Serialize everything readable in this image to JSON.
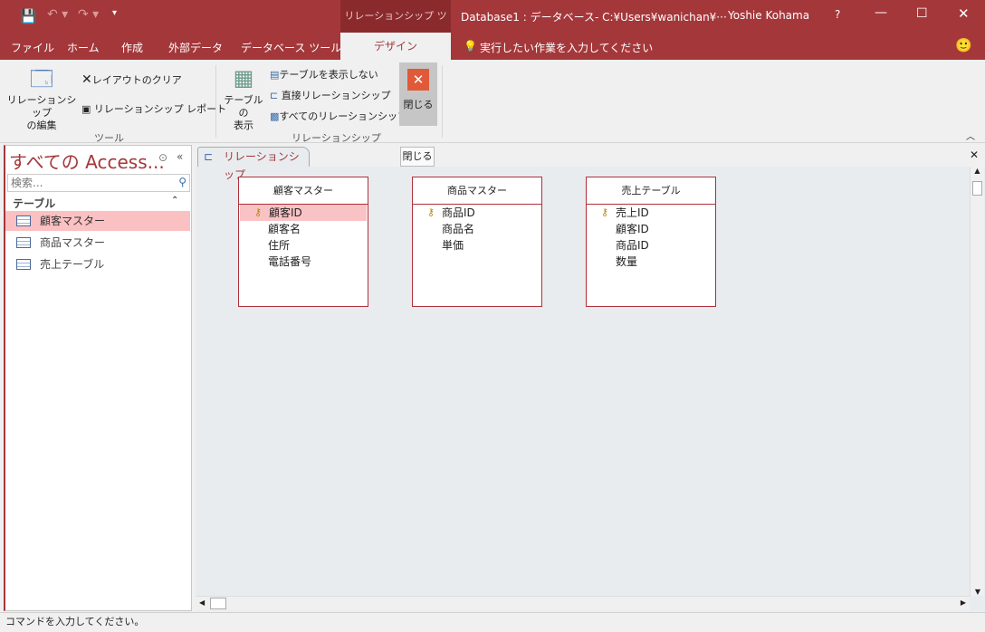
{
  "titlebar": {
    "context_tab": "リレーションシップ ツール",
    "title": "Database1 : データベース- C:¥Users¥wanichan¥···",
    "user": "Yoshie Kohama",
    "help": "?"
  },
  "tabs": [
    "ファイル",
    "ホーム",
    "作成",
    "外部データ",
    "データベース ツール",
    "デザイン"
  ],
  "tell_me": "実行したい作業を入力してください",
  "ribbon": {
    "edit_relationships": "リレーションシップ\nの編集",
    "clear_layout": "レイアウトのクリア",
    "relationship_report": "リレーションシップ レポート",
    "group_tools": "ツール",
    "show_table": "テーブルの\n表示",
    "hide_table": "テーブルを表示しない",
    "direct_relationships": "直接リレーションシップ",
    "all_relationships": "すべてのリレーションシップ",
    "group_relationships": "リレーションシップ",
    "close": "閉じる"
  },
  "nav": {
    "title": "すべての Access...",
    "search_placeholder": "検索...",
    "section": "テーブル",
    "items": [
      "顧客マスター",
      "商品マスター",
      "売上テーブル"
    ]
  },
  "doc": {
    "tab": "リレーションシップ",
    "tooltip": "閉じる",
    "tables": [
      {
        "name": "顧客マスター",
        "fields": [
          "顧客ID",
          "顧客名",
          "住所",
          "電話番号"
        ],
        "key": 0
      },
      {
        "name": "商品マスター",
        "fields": [
          "商品ID",
          "商品名",
          "単価"
        ],
        "key": 0
      },
      {
        "name": "売上テーブル",
        "fields": [
          "売上ID",
          "顧客ID",
          "商品ID",
          "数量"
        ],
        "key": 0
      }
    ]
  },
  "status": "コマンドを入力してください。",
  "colors": {
    "brand": "#a4373a",
    "selection": "#fac0c2"
  }
}
